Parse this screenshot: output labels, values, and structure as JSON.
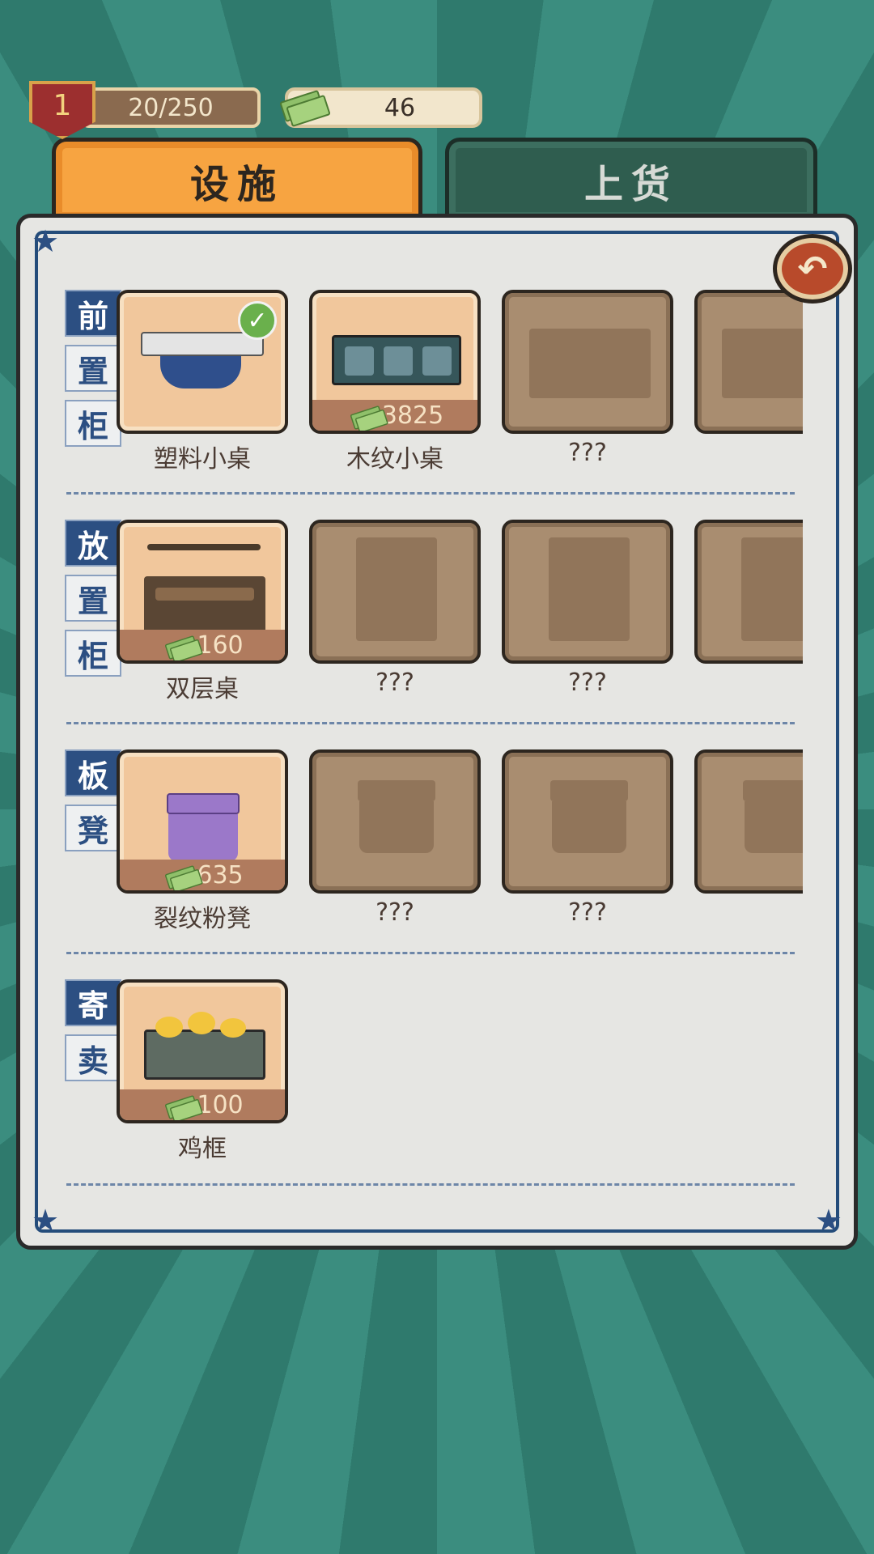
{
  "hud": {
    "level": "1",
    "xp": "20/250",
    "money": "46"
  },
  "tabs": [
    {
      "label": "设施",
      "active": true
    },
    {
      "label": "上货",
      "active": false
    }
  ],
  "back_icon": "undo-arrow-icon",
  "sections": [
    {
      "label_chars": [
        "前",
        "置",
        "柜"
      ],
      "items": [
        {
          "name": "塑料小桌",
          "price": "",
          "unlocked": true,
          "owned": true,
          "icon": "plastic-table-icon"
        },
        {
          "name": "木纹小桌",
          "price": "3825",
          "unlocked": true,
          "owned": false,
          "icon": "wood-counter-icon"
        },
        {
          "name": "???",
          "price": "",
          "unlocked": false,
          "owned": false,
          "icon": "locked-counter-icon"
        },
        {
          "name": "",
          "price": "",
          "unlocked": false,
          "owned": false,
          "icon": "locked-counter-icon"
        }
      ]
    },
    {
      "label_chars": [
        "放",
        "置",
        "柜"
      ],
      "items": [
        {
          "name": "双层桌",
          "price": "160",
          "unlocked": true,
          "owned": false,
          "icon": "double-shelf-table-icon"
        },
        {
          "name": "???",
          "price": "",
          "unlocked": false,
          "owned": false,
          "icon": "locked-shelf-icon"
        },
        {
          "name": "???",
          "price": "",
          "unlocked": false,
          "owned": false,
          "icon": "locked-shelf-icon"
        },
        {
          "name": "",
          "price": "",
          "unlocked": false,
          "owned": false,
          "icon": "locked-shelf-icon"
        }
      ]
    },
    {
      "label_chars": [
        "板",
        "凳"
      ],
      "items": [
        {
          "name": "裂纹粉凳",
          "price": "635",
          "unlocked": true,
          "owned": false,
          "icon": "purple-stool-icon"
        },
        {
          "name": "???",
          "price": "",
          "unlocked": false,
          "owned": false,
          "icon": "locked-stool-icon"
        },
        {
          "name": "???",
          "price": "",
          "unlocked": false,
          "owned": false,
          "icon": "locked-stool-icon"
        },
        {
          "name": "",
          "price": "",
          "unlocked": false,
          "owned": false,
          "icon": "locked-stool-icon"
        }
      ]
    },
    {
      "label_chars": [
        "寄",
        "卖"
      ],
      "items": [
        {
          "name": "鸡框",
          "price": "100",
          "unlocked": true,
          "owned": false,
          "icon": "chick-crate-icon"
        }
      ]
    }
  ]
}
